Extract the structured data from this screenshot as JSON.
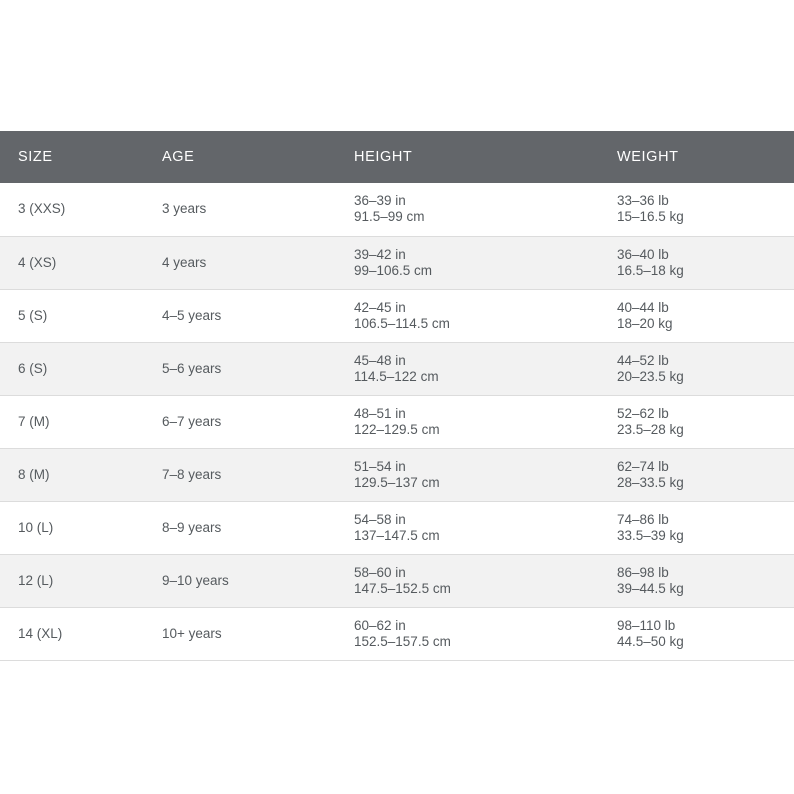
{
  "headers": {
    "size": "SIZE",
    "age": "AGE",
    "height": "HEIGHT",
    "weight": "WEIGHT"
  },
  "rows": [
    {
      "size": "3 (XXS)",
      "age": "3 years",
      "height_in": "36–39 in",
      "height_cm": "91.5–99 cm",
      "weight_lb": "33–36 lb",
      "weight_kg": "15–16.5 kg"
    },
    {
      "size": "4 (XS)",
      "age": "4 years",
      "height_in": "39–42 in",
      "height_cm": "99–106.5 cm",
      "weight_lb": "36–40 lb",
      "weight_kg": "16.5–18 kg"
    },
    {
      "size": "5 (S)",
      "age": "4–5 years",
      "height_in": "42–45 in",
      "height_cm": "106.5–114.5 cm",
      "weight_lb": "40–44 lb",
      "weight_kg": "18–20 kg"
    },
    {
      "size": "6 (S)",
      "age": "5–6 years",
      "height_in": "45–48 in",
      "height_cm": "114.5–122 cm",
      "weight_lb": "44–52 lb",
      "weight_kg": "20–23.5 kg"
    },
    {
      "size": "7 (M)",
      "age": "6–7 years",
      "height_in": "48–51 in",
      "height_cm": "122–129.5 cm",
      "weight_lb": "52–62 lb",
      "weight_kg": "23.5–28 kg"
    },
    {
      "size": "8 (M)",
      "age": "7–8 years",
      "height_in": "51–54 in",
      "height_cm": "129.5–137 cm",
      "weight_lb": "62–74 lb",
      "weight_kg": "28–33.5 kg"
    },
    {
      "size": "10 (L)",
      "age": "8–9 years",
      "height_in": "54–58 in",
      "height_cm": "137–147.5 cm",
      "weight_lb": "74–86 lb",
      "weight_kg": "33.5–39 kg"
    },
    {
      "size": "12 (L)",
      "age": "9–10 years",
      "height_in": "58–60 in",
      "height_cm": "147.5–152.5 cm",
      "weight_lb": "86–98 lb",
      "weight_kg": "39–44.5 kg"
    },
    {
      "size": "14 (XL)",
      "age": "10+ years",
      "height_in": "60–62 in",
      "height_cm": "152.5–157.5 cm",
      "weight_lb": "98–110 lb",
      "weight_kg": "44.5–50 kg"
    }
  ]
}
